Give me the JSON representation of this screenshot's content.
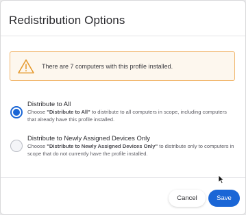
{
  "dialog": {
    "title": "Redistribution Options"
  },
  "alert": {
    "icon": "warning-triangle-icon",
    "message": "There are 7 computers with this profile installed."
  },
  "options": [
    {
      "label": "Distribute to All",
      "selected": true,
      "description": {
        "prefix": "Choose ",
        "emphasis": "\"Distribute to All\"",
        "suffix": " to distribute to all computers in scope, including computers that already have this profile installed."
      }
    },
    {
      "label": "Distribute to Newly Assigned Devices Only",
      "selected": false,
      "description": {
        "prefix": "Choose ",
        "emphasis": "\"Distribute to Newly Assigned Devices Only\"",
        "suffix": " to distribute only to computers in scope that do not currently have the profile installed."
      }
    }
  ],
  "footer": {
    "cancel_label": "Cancel",
    "save_label": "Save"
  },
  "colors": {
    "accent": "#1a66d6",
    "warning_border": "#f1b56a",
    "warning_bg": "#fdf7ee",
    "warning_icon": "#e59a2f"
  }
}
